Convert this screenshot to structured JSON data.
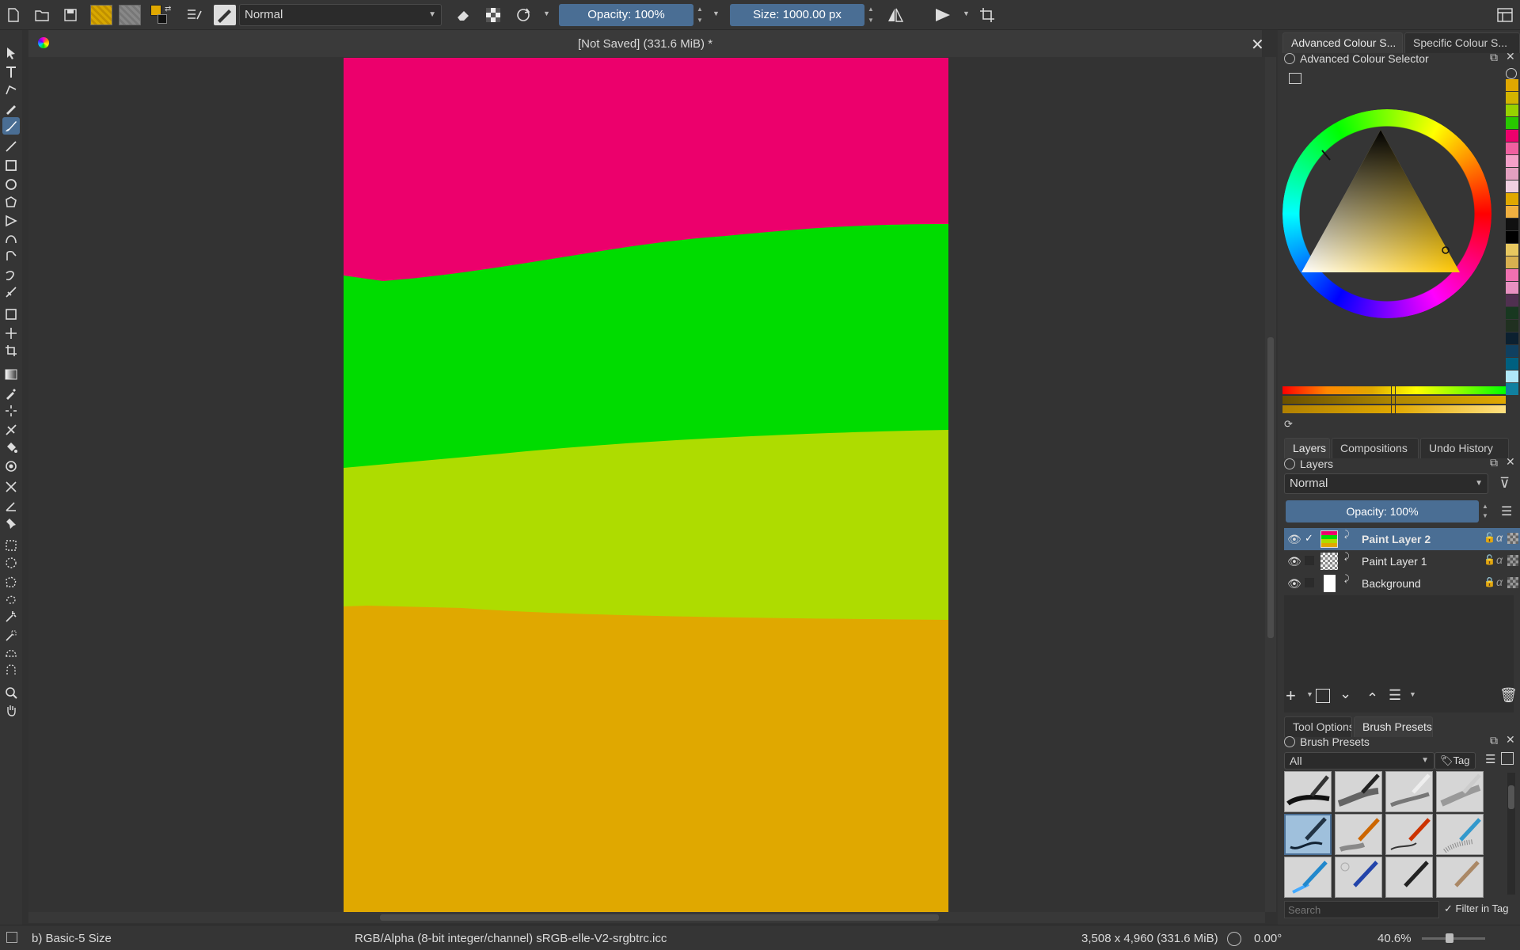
{
  "toolbar": {
    "blend_mode": "Normal",
    "opacity_label": "Opacity: 100%",
    "size_label": "Size: 1000.00 px",
    "fg_color": "#e0a800"
  },
  "document": {
    "title": "[Not Saved]  (331.6 MiB) *",
    "bands": [
      {
        "name": "pink",
        "color": "#ec006c"
      },
      {
        "name": "green",
        "color": "#00dc00"
      },
      {
        "name": "yellow-green",
        "color": "#aedc00"
      },
      {
        "name": "orange",
        "color": "#e0a800"
      }
    ]
  },
  "status": {
    "brush": "b) Basic-5 Size",
    "color_space": "RGB/Alpha (8-bit integer/channel)  sRGB-elle-V2-srgbtrc.icc",
    "dimensions": "3,508 x 4,960 (331.6 MiB)",
    "rotation": "0.00°",
    "zoom": "40.6%"
  },
  "dock": {
    "color_tabs": [
      "Advanced Colour S...",
      "Specific Colour S..."
    ],
    "color_title": "Advanced Colour Selector",
    "palette": [
      "#e0a800",
      "#d2b400",
      "#96d200",
      "#28c800",
      "#ec006c",
      "#f060a0",
      "#f4a0c8",
      "#e4a0c0",
      "#f0d0e0",
      "#e0a800",
      "#f0b040",
      "#101010",
      "#000000",
      "#e8c860",
      "#d8b050",
      "#f070b0",
      "#e890c0",
      "#503050",
      "#183820",
      "#203020",
      "#0c2030",
      "#104060",
      "#006080",
      "#b0e8f8",
      "#1080a0"
    ],
    "layers_tabs": [
      "Layers",
      "Compositions",
      "Undo History"
    ],
    "layers_title": "Layers",
    "layers_blend": "Normal",
    "layers_opacity": "Opacity:  100%",
    "layers": [
      {
        "name": "Paint Layer 2",
        "selected": true
      },
      {
        "name": "Paint Layer 1",
        "selected": false
      },
      {
        "name": "Background",
        "selected": false
      }
    ],
    "brush_tabs": [
      "Tool Options",
      "Brush Presets"
    ],
    "brush_title": "Brush Presets",
    "brush_filter": "All",
    "tag_label": "Tag",
    "search_placeholder": "Search",
    "filter_in_tag": "Filter in Tag"
  }
}
